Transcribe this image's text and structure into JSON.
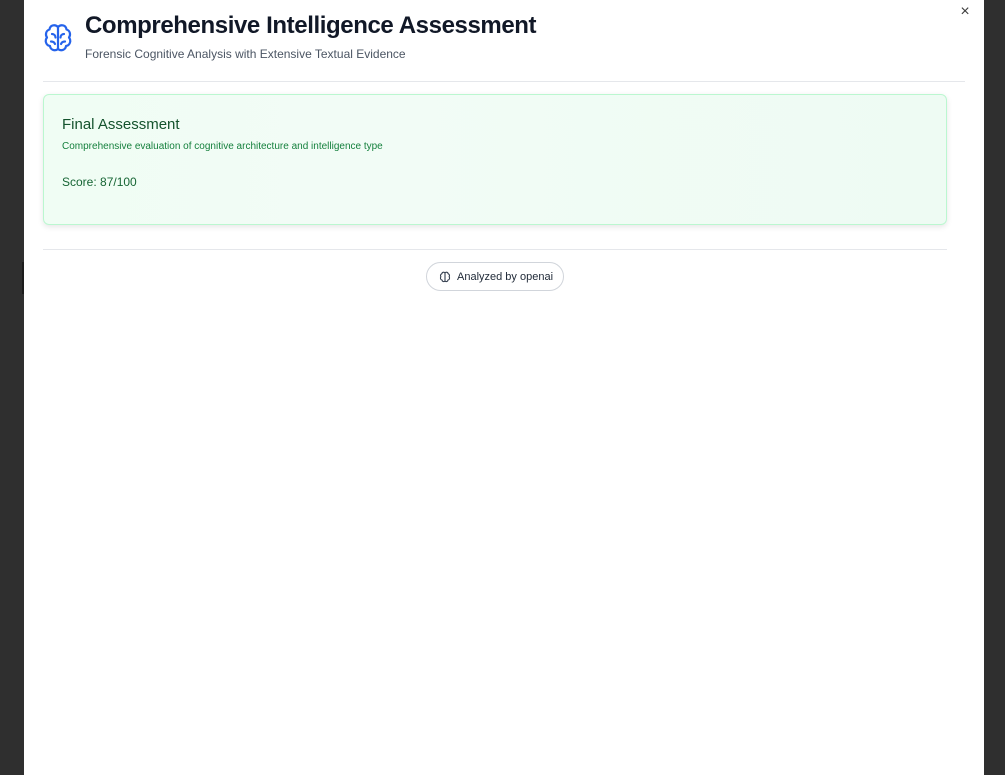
{
  "dialog": {
    "close_label": "×",
    "title": "Comprehensive Intelligence Assessment",
    "subtitle": "Forensic Cognitive Analysis with Extensive Textual Evidence",
    "icon": "brain-icon",
    "accent_color": "#2563eb"
  },
  "final_assessment": {
    "title": "Final Assessment",
    "description": "Comprehensive evaluation of cognitive architecture and intelligence type",
    "score_text": "Score: 87/100",
    "score": 87,
    "score_max": 100,
    "colors": {
      "background": "#f0fdf4",
      "border": "#bbf7d0",
      "title": "#14532d",
      "text": "#15803d"
    }
  },
  "footer": {
    "badge_label": "Analyzed by openai",
    "badge_icon": "brain-icon"
  }
}
